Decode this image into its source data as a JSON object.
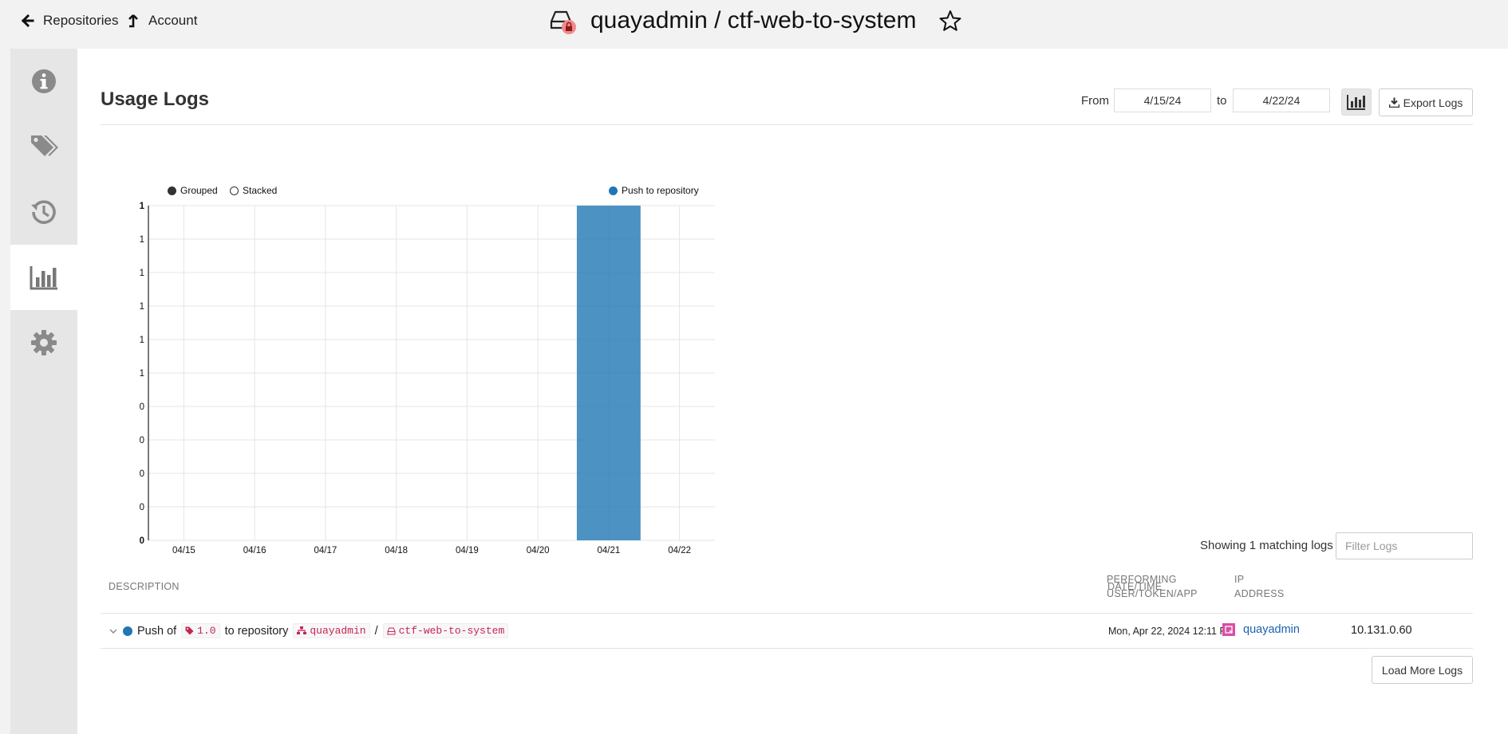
{
  "topbar": {
    "back_label": "Repositories",
    "account_label": "Account",
    "repo_title": "quayadmin / ctf-web-to-system",
    "icons": {
      "back": "arrow-left-icon",
      "account": "level-up-icon",
      "repo": "hdd-lock-icon",
      "star": "star-outline-icon"
    }
  },
  "sidebar": {
    "items": [
      {
        "name": "info",
        "icon": "info-circle-icon",
        "active": false
      },
      {
        "name": "tags",
        "icon": "tags-icon",
        "active": false
      },
      {
        "name": "history",
        "icon": "history-icon",
        "active": false
      },
      {
        "name": "usage-logs",
        "icon": "bar-chart-icon",
        "active": true
      },
      {
        "name": "settings",
        "icon": "gear-icon",
        "active": false
      }
    ]
  },
  "header": {
    "title": "Usage Logs",
    "from_label": "From",
    "from_date": "4/15/24",
    "to_label": "to",
    "to_date": "4/22/24",
    "export_label": "Export Logs"
  },
  "chart_data": {
    "type": "bar",
    "categories": [
      "04/15",
      "04/16",
      "04/17",
      "04/18",
      "04/19",
      "04/20",
      "04/21",
      "04/22"
    ],
    "series": [
      {
        "name": "Push to repository",
        "values": [
          0,
          0,
          0,
          0,
          0,
          0,
          1,
          0
        ],
        "color": "#1f77b4"
      }
    ],
    "y_tick_labels": [
      "1",
      "1",
      "1",
      "1",
      "1",
      "1",
      "0",
      "0",
      "0",
      "0",
      "0"
    ],
    "ylim": [
      0,
      1
    ],
    "grid": true,
    "mode_options": [
      "Grouped",
      "Stacked"
    ],
    "mode_selected": "Grouped",
    "legend_position": "top-right"
  },
  "logs": {
    "showing_text": "Showing 1 matching logs",
    "filter_placeholder": "Filter Logs",
    "columns": {
      "description": "Description",
      "datetime": "Date/Time",
      "performer": "Performing User/Token/App",
      "ip": "IP Address"
    },
    "rows": [
      {
        "prefix": "Push of",
        "tag": "1.0",
        "middle": "to repository",
        "namespace": "quayadmin",
        "separator": "/",
        "repository": "ctf-web-to-system",
        "datetime": "Mon, Apr 22, 2024 12:11 PM",
        "user": "quayadmin",
        "ip": "10.131.0.60"
      }
    ],
    "load_more_label": "Load More Logs"
  },
  "colors": {
    "accent": "#1f77b4",
    "sidebar_bg": "#e6e6e6",
    "sidebar_icon": "#8a8a8a",
    "lock_badge": "#f08a8a",
    "code_text": "#c7254e",
    "avatar": "#d94ea6",
    "link": "#1a62b0"
  }
}
